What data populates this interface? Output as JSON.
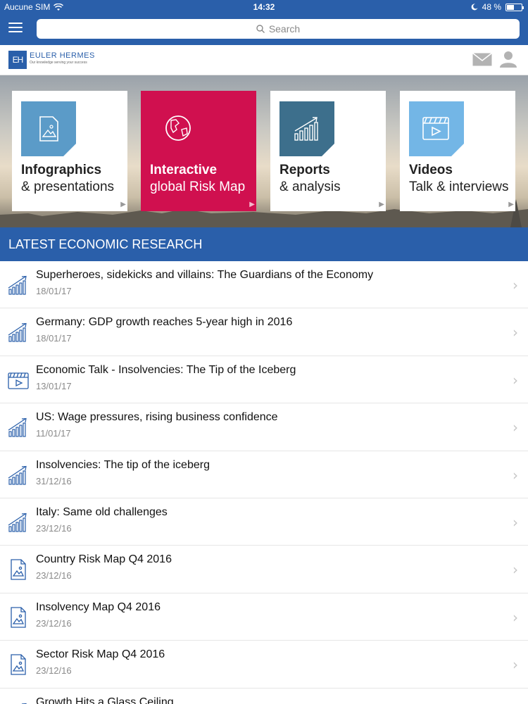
{
  "status_bar": {
    "carrier": "Aucune SIM",
    "time": "14:32",
    "battery": "48 %",
    "battery_level": 0.48
  },
  "nav": {
    "search_placeholder": "Search"
  },
  "header": {
    "logo_mark": "EH",
    "logo_name": "EULER HERMES",
    "logo_tagline": "Our knowledge serving your success"
  },
  "cards": [
    {
      "title": "Infographics",
      "subtitle": "& presentations",
      "icon": "image-document-icon",
      "active": false
    },
    {
      "title": "Interactive",
      "subtitle": "global Risk Map",
      "icon": "globe-icon",
      "active": true
    },
    {
      "title": "Reports",
      "subtitle": "& analysis",
      "icon": "chart-icon",
      "active": false
    },
    {
      "title": "Videos",
      "subtitle": "Talk & interviews",
      "icon": "video-icon",
      "active": false
    }
  ],
  "section_title": "LATEST ECONOMIC RESEARCH",
  "items": [
    {
      "title": "Superheroes, sidekicks and villains: The Guardians of the Economy",
      "date": "18/01/17",
      "icon": "chart-icon"
    },
    {
      "title": "Germany: GDP growth reaches 5-year high in 2016",
      "date": "18/01/17",
      "icon": "chart-icon"
    },
    {
      "title": "Economic Talk - Insolvencies: The Tip of the Iceberg",
      "date": "13/01/17",
      "icon": "video-icon"
    },
    {
      "title": "US: Wage pressures, rising business confidence",
      "date": "11/01/17",
      "icon": "chart-icon"
    },
    {
      "title": "Insolvencies: The tip of the iceberg",
      "date": "31/12/16",
      "icon": "chart-icon"
    },
    {
      "title": "Italy: Same old challenges",
      "date": "23/12/16",
      "icon": "chart-icon"
    },
    {
      "title": "Country Risk Map Q4 2016",
      "date": "23/12/16",
      "icon": "image-document-icon"
    },
    {
      "title": "Insolvency Map Q4 2016",
      "date": "23/12/16",
      "icon": "image-document-icon"
    },
    {
      "title": "Sector Risk Map Q4 2016",
      "date": "23/12/16",
      "icon": "image-document-icon"
    },
    {
      "title": "Growth Hits a Glass Ceiling",
      "date": "",
      "icon": "chart-icon"
    }
  ],
  "colors": {
    "brand_blue": "#2a5faa",
    "accent_magenta": "#d0104f",
    "card_icon_blue": "#5b9bc8",
    "card_icon_dark": "#3d6f8c",
    "card_icon_light": "#73b6e6"
  }
}
